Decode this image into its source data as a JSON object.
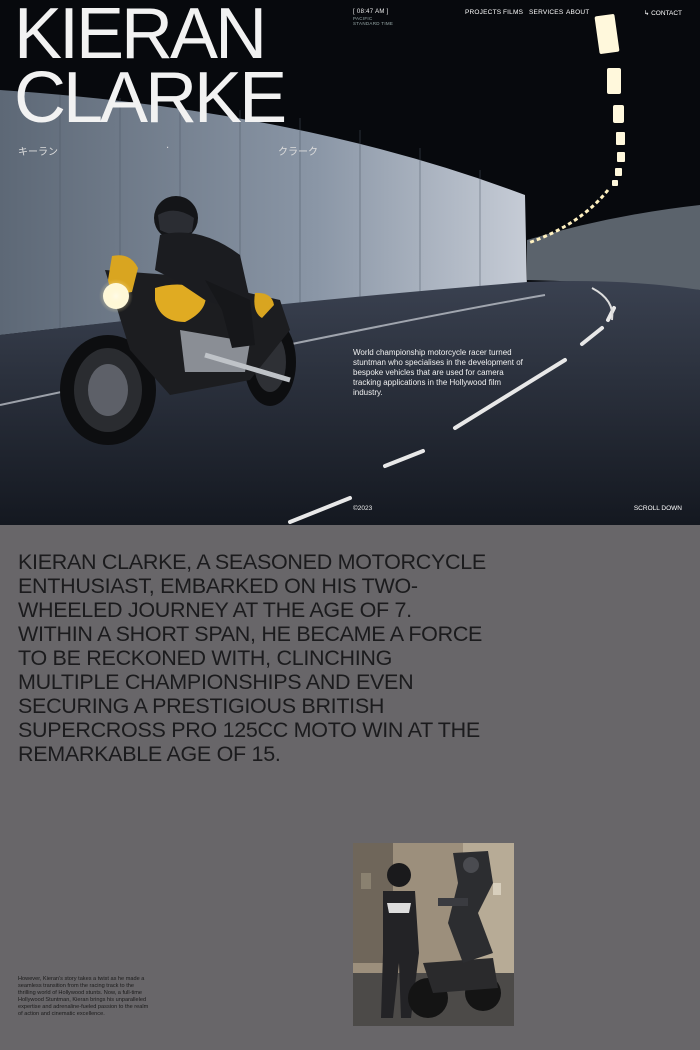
{
  "hero": {
    "name_line1": "KIERAN",
    "name_line2": "CLARKE",
    "jp_left": "キーラン",
    "jp_dot": "·",
    "jp_right": "クラーク",
    "time": "[ 08:47 AM ]",
    "timezone_line1": "PACIFIC",
    "timezone_line2": "STANDARD TIME",
    "blurb": "World championship motorcycle racer turned stuntman who specialises in the development of bespoke vehicles that are used for camera tracking applications in the Hollywood film industry.",
    "copyright": "©2023",
    "scroll_label": "SCROLL DOWN"
  },
  "nav": {
    "items": [
      "PROJECTS",
      "FILMS",
      "SERVICES",
      "ABOUT"
    ],
    "contact_label": "↳ CONTACT"
  },
  "intro": {
    "statement": "KIERAN CLARKE, A SEASONED MOTORCYCLE ENTHUSIAST, EMBARKED ON HIS TWO-WHEELED JOURNEY AT THE AGE OF 7. WITHIN A SHORT SPAN, HE BECAME A FORCE TO BE RECKONED WITH, CLINCHING MULTIPLE CHAMPIONSHIPS AND EVEN SECURING A PRESTIGIOUS BRITISH SUPERCROSS PRO 125CC MOTO WIN AT THE REMARKABLE AGE OF 15.",
    "secondary": "However, Kieran's story takes a twist as he made a seamless transition from the racing track to the thrilling world of Hollywood stunts. Now, a full-time Hollywood Stuntman, Kieran brings his unparalleled expertise and adrenaline-fueled passion to the realm of action and cinematic excellence."
  },
  "colors": {
    "section_bg": "#686669",
    "statement_text": "#1b1b1d",
    "bike_yellow": "#d9a520"
  }
}
